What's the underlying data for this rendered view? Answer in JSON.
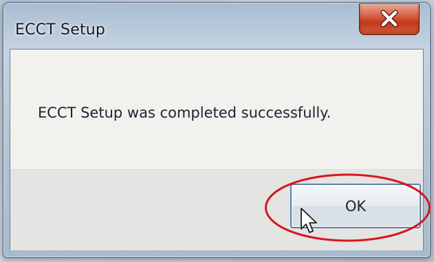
{
  "window": {
    "title": "ECCT Setup",
    "close_icon": "close-x-icon"
  },
  "dialog": {
    "message": "ECCT Setup was completed successfully.",
    "ok_label": "OK"
  },
  "annotation": {
    "highlight_color": "#d8151c",
    "cursor_icon": "arrow-pointer-icon"
  },
  "colors": {
    "close_button": "#c4381a",
    "client_background": "#f1f1ee"
  }
}
